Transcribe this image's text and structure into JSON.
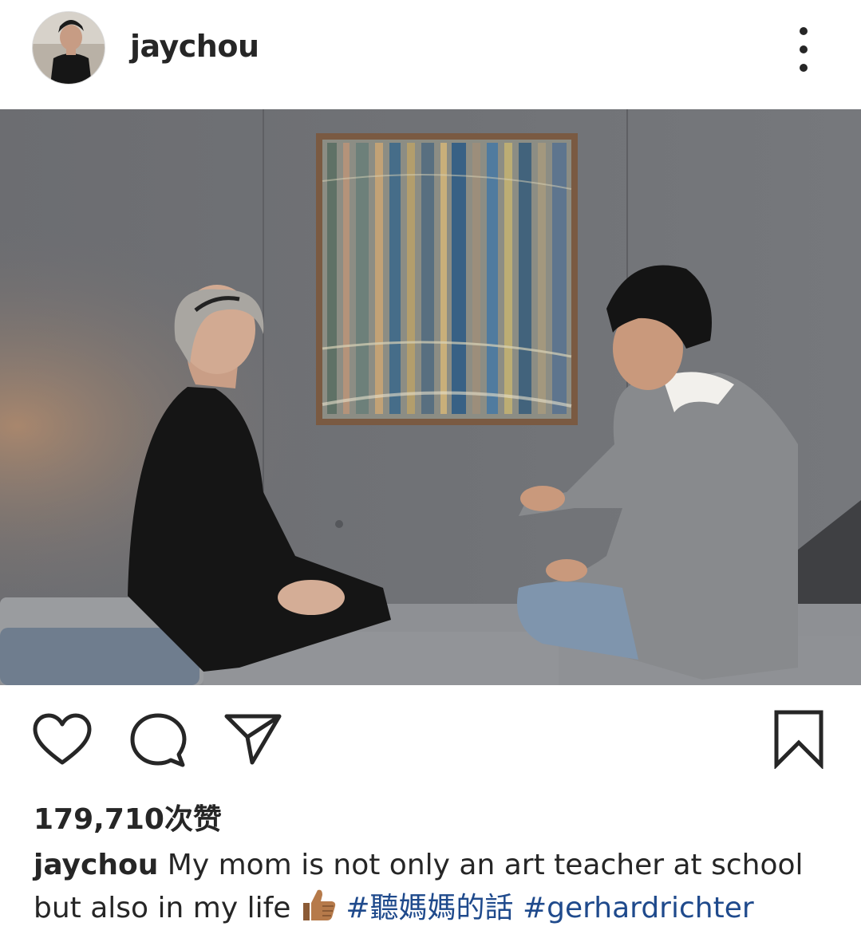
{
  "post": {
    "username": "jaychou",
    "likes_text": "179,710次赞",
    "caption": {
      "username": "jaychou",
      "text_line1": "My mom is not only an art teacher at school",
      "text_line2": "but also in my life",
      "emoji": "thumbs-up",
      "hashtags": [
        "#聽媽媽的話",
        "#gerhardrichter"
      ]
    }
  },
  "icons": {
    "more": "more-vertical-icon",
    "like": "heart-icon",
    "comment": "comment-bubble-icon",
    "share": "paper-plane-icon",
    "save": "bookmark-icon"
  },
  "colors": {
    "text": "#262626",
    "hashtag": "#1f4a8c",
    "background": "#ffffff"
  }
}
